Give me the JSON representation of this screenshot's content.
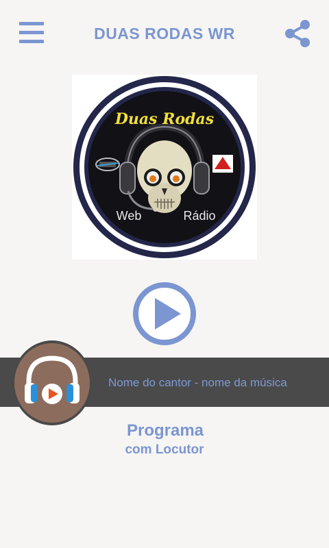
{
  "header": {
    "title": "DUAS RODAS WR",
    "menu_icon": "hamburger-menu-icon",
    "share_icon": "share-icon"
  },
  "logo": {
    "top_text": "Duas Rodas",
    "left_text": "Web",
    "right_text": "Rádio"
  },
  "player": {
    "play_icon": "play-icon",
    "now_playing": "Nome do cantor - nome da música",
    "badge_icon": "headphones-icon"
  },
  "program": {
    "line1": "Programa",
    "line2": "com Locutor"
  },
  "colors": {
    "accent": "#7b96d0",
    "background": "#f6f5f4",
    "bar": "#4a4a4a",
    "badge": "#8c6d5d"
  }
}
